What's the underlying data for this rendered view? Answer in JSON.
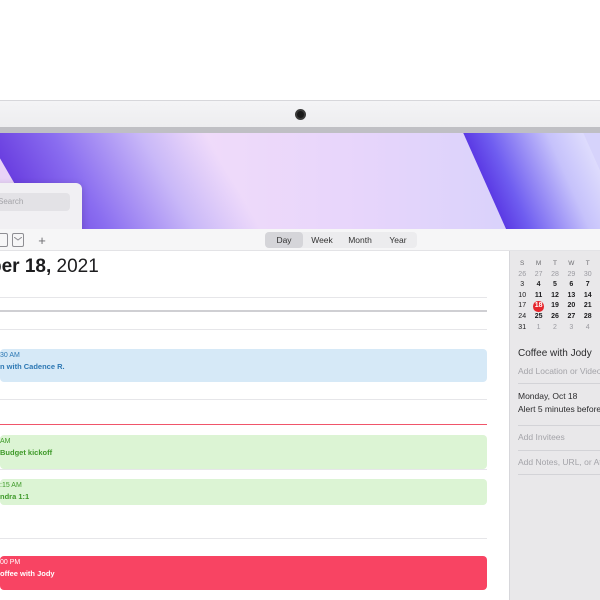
{
  "search": {
    "placeholder": "Search"
  },
  "toolbar": {
    "add_label": "+",
    "views": [
      "Day",
      "Week",
      "Month",
      "Year"
    ],
    "active_view": "Day"
  },
  "header": {
    "month_fragment": "ber 18,",
    "year": " 2021"
  },
  "events": [
    {
      "time": "30 AM",
      "title": "n with Cadence R.",
      "color": "#d6e9f7"
    },
    {
      "time": "AM",
      "title": " Budget kickoff",
      "color": "#dcf4d4"
    },
    {
      "time": ":15 AM",
      "title": "ndra 1:1",
      "color": "#dcf4d4"
    },
    {
      "time": "00 PM",
      "title": "offee with Jody",
      "color": "#f84463"
    }
  ],
  "mini_calendar": {
    "weekday_headers": [
      "S",
      "M",
      "T",
      "W",
      "T"
    ],
    "weeks": [
      [
        "26",
        "27",
        "28",
        "29",
        "30"
      ],
      [
        "3",
        "4",
        "5",
        "6",
        "7"
      ],
      [
        "10",
        "11",
        "12",
        "13",
        "14"
      ],
      [
        "17",
        "18",
        "19",
        "20",
        "21"
      ],
      [
        "24",
        "25",
        "26",
        "27",
        "28"
      ],
      [
        "31",
        "1",
        "2",
        "3",
        "4"
      ]
    ],
    "today": "18"
  },
  "inspector": {
    "title": "Coffee with Jody",
    "location_placeholder": "Add Location or Video",
    "date": "Monday, Oct 18",
    "alert": "Alert 5 minutes before",
    "invitees_placeholder": "Add Invitees",
    "notes_placeholder": "Add Notes, URL, or Att"
  },
  "colors": {
    "today_accent": "#e5262c",
    "now_line": "#f0556a"
  }
}
